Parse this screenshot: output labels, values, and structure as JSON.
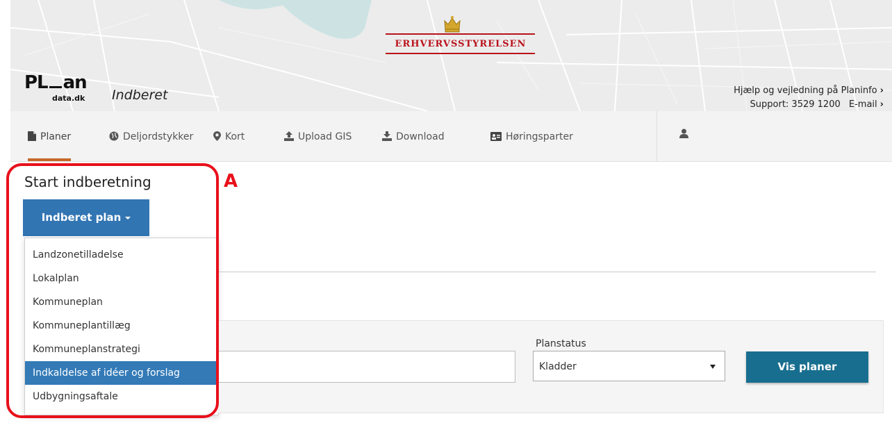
{
  "header": {
    "agency": "ERHVERVSSTYRELSEN",
    "logo_main_left": "PL",
    "logo_main_right": "an",
    "logo_sub": "data.dk",
    "app_name": "Indberet",
    "help_link": "Hjælp og vejledning på Planinfo",
    "support": "Support: 3529 1200",
    "email": "E-mail",
    "chevron": "›"
  },
  "nav": {
    "tabs": [
      {
        "label": "Planer",
        "icon": "file-icon",
        "active": true
      },
      {
        "label": "Deljordstykker",
        "icon": "globe-icon"
      },
      {
        "label": "Kort",
        "icon": "map-marker-icon"
      },
      {
        "label": "Upload GIS",
        "icon": "upload-icon"
      },
      {
        "label": "Download",
        "icon": "download-icon"
      },
      {
        "label": "Høringsparter",
        "icon": "contact-card-icon"
      }
    ],
    "user_icon": "user-icon"
  },
  "main": {
    "start_title": "Start indberetning",
    "indberet_button": "Indberet plan",
    "dropdown": [
      "Landzonetilladelse",
      "Lokalplan",
      "Kommuneplan",
      "Kommuneplantillæg",
      "Kommuneplanstrategi",
      "Indkaldelse af idéer og forslag",
      "Udbygningsaftale"
    ],
    "dropdown_active_index": 5,
    "planstatus_label": "Planstatus",
    "planstatus_value": "Kladder",
    "vis_planer_button": "Vis planer"
  },
  "annotation": {
    "letter": "A",
    "color": "#e8101b"
  },
  "colors": {
    "primary_button": "#3275b3",
    "vis_button": "#186e8f",
    "active_tab_underline": "#c8682a",
    "agency_red": "#b9121b"
  }
}
